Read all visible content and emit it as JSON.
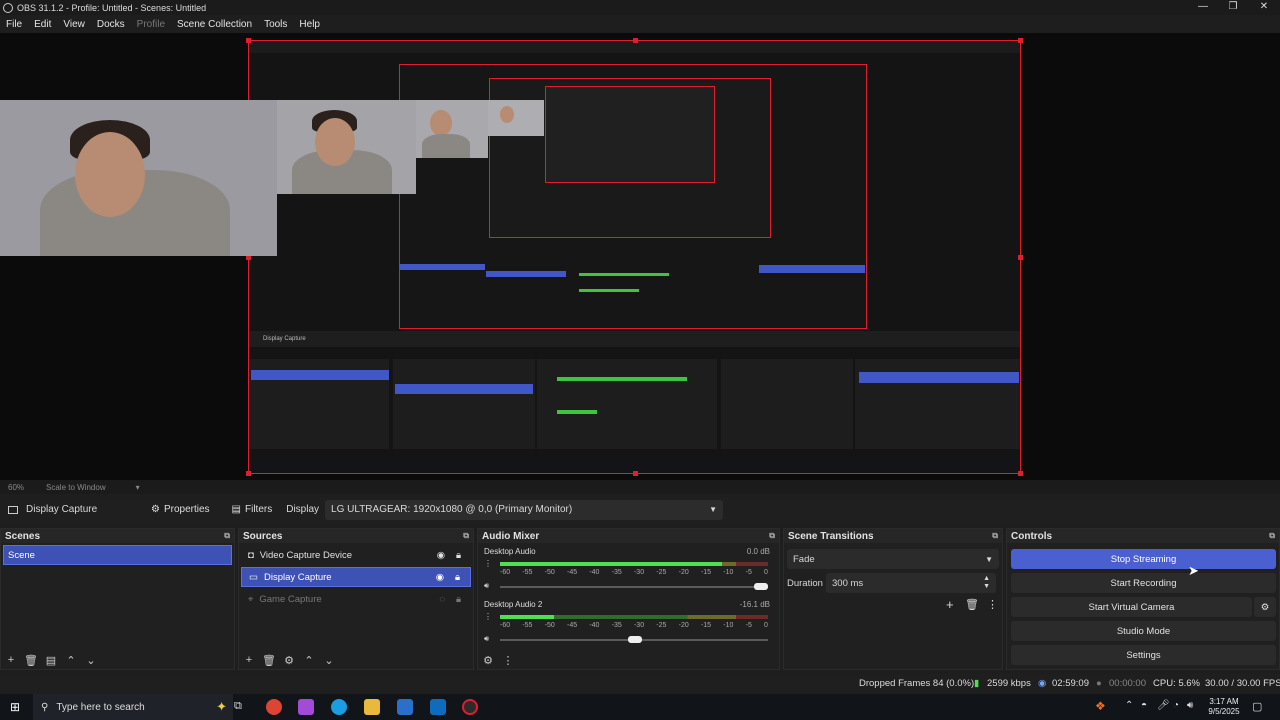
{
  "title_bar": {
    "title": "OBS 31.1.2 - Profile: Untitled - Scenes: Untitled",
    "minimize": "—",
    "restore": "❐",
    "close": "✕"
  },
  "menu": [
    "File",
    "Edit",
    "View",
    "Docks",
    "Profile",
    "Scene Collection",
    "Tools",
    "Help"
  ],
  "scale_bar": {
    "zoom": "60%",
    "mode": "Scale to Window"
  },
  "properties_bar": {
    "source_name": "Display Capture",
    "properties_label": "Properties",
    "filters_label": "Filters",
    "display_label": "Display",
    "display_value": "LG ULTRAGEAR: 1920x1080 @ 0,0 (Primary Monitor)"
  },
  "scenes": {
    "title": "Scenes",
    "items": [
      "Scene"
    ]
  },
  "sources": {
    "title": "Sources",
    "items": [
      "Video Capture Device",
      "Display Capture",
      "Game Capture"
    ]
  },
  "mixer": {
    "title": "Audio Mixer",
    "channels": [
      {
        "name": "Desktop Audio",
        "db": "0.0 dB",
        "level": 0.83,
        "volume": 1.0
      },
      {
        "name": "Desktop Audio 2",
        "db": "-16.1 dB",
        "level": 0.2,
        "volume": 0.53
      }
    ],
    "ticks": [
      "-60",
      "-55",
      "-50",
      "-45",
      "-40",
      "-35",
      "-30",
      "-25",
      "-20",
      "-15",
      "-10",
      "-5",
      "0"
    ]
  },
  "transitions": {
    "title": "Scene Transitions",
    "type": "Fade",
    "duration_label": "Duration",
    "duration_value": "300 ms"
  },
  "controls": {
    "title": "Controls",
    "stop_streaming": "Stop Streaming",
    "start_recording": "Start Recording",
    "start_virtual_camera": "Start Virtual Camera",
    "studio_mode": "Studio Mode",
    "settings": "Settings"
  },
  "status": {
    "dropped_frames": "Dropped Frames 84 (0.0%)",
    "bitrate": "2599 kbps",
    "stream_time": "02:59:09",
    "record_time": "00:00:00",
    "cpu": "CPU: 5.6%",
    "fps": "30.00 / 30.00 FPS"
  },
  "taskbar": {
    "search_placeholder": "Type here to search",
    "time": "3:17 AM",
    "date": "9/5/2025"
  },
  "colors": {
    "accent": "#4a5fd0",
    "selection_border": "#e01e2e",
    "meter_green": "#4fdf4f"
  }
}
